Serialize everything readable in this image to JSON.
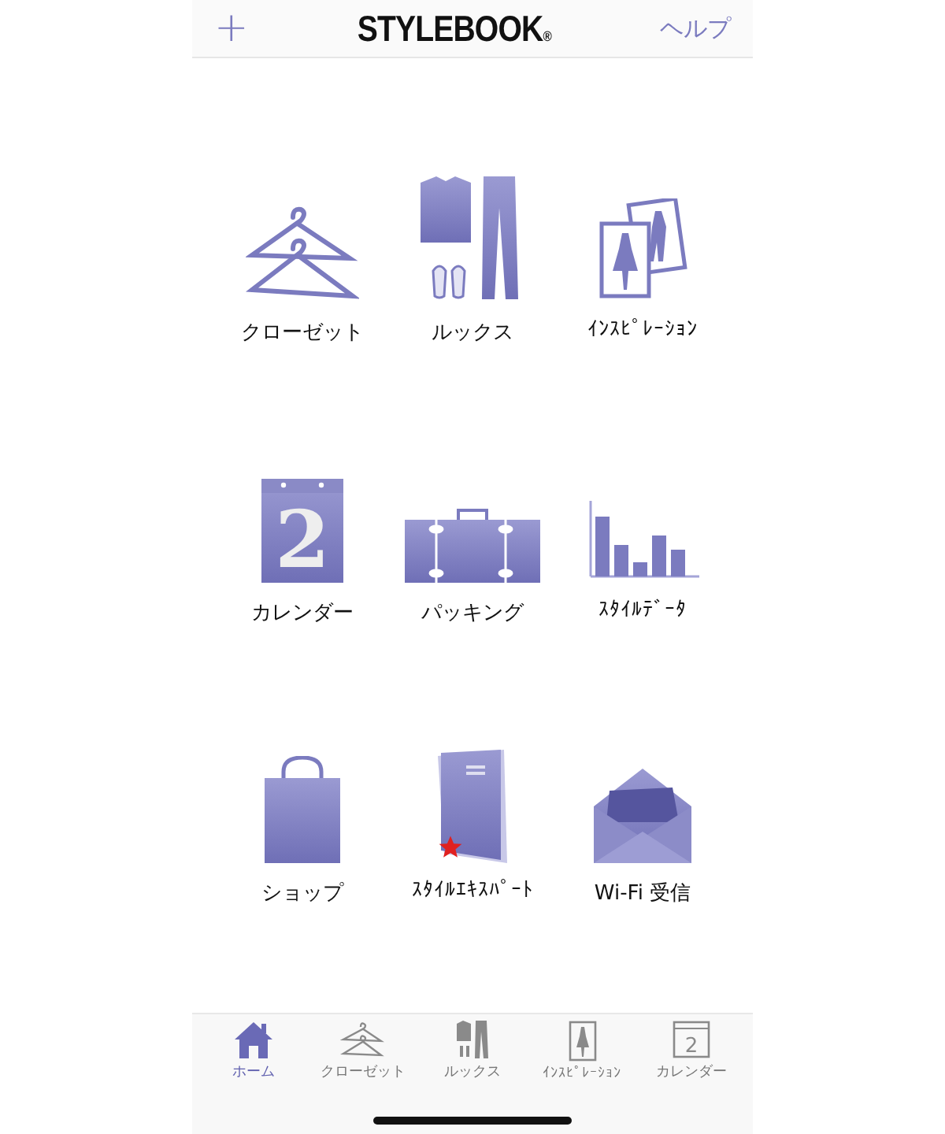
{
  "header": {
    "add_button": "+",
    "title": "STYLEBOOK",
    "title_mark": "®",
    "help_link": "ヘルプ"
  },
  "tiles": [
    {
      "kind": "closet",
      "label": "クローゼット",
      "starred": false
    },
    {
      "kind": "looks",
      "label": "ルックス",
      "starred": false
    },
    {
      "kind": "inspiration",
      "label": "ｲﾝｽﾋﾟﾚｰｼｮﾝ",
      "starred": false
    },
    {
      "kind": "calendar",
      "label": "カレンダー",
      "icon_text": "2",
      "starred": false
    },
    {
      "kind": "packing",
      "label": "パッキング",
      "starred": false
    },
    {
      "kind": "data",
      "label": "ｽﾀｲﾙﾃﾞｰﾀ",
      "starred": false
    },
    {
      "kind": "shop",
      "label": "ショップ",
      "starred": false
    },
    {
      "kind": "expert",
      "label": "ｽﾀｲﾙｴｷｽﾊﾟｰﾄ",
      "starred": true
    },
    {
      "kind": "wifi",
      "label": "Wi-Fi 受信",
      "starred": false
    }
  ],
  "tab_bar": [
    {
      "kind": "home",
      "label": "ホーム",
      "selected": true
    },
    {
      "kind": "closet",
      "label": "クローゼット",
      "selected": false
    },
    {
      "kind": "looks",
      "label": "ルックス",
      "selected": false
    },
    {
      "kind": "inspiration",
      "label": "ｲﾝｽﾋﾟﾚｰｼｮﾝ",
      "selected": false
    },
    {
      "kind": "calendar",
      "label": "カレンダー",
      "icon_text": "2",
      "selected": false
    }
  ]
}
